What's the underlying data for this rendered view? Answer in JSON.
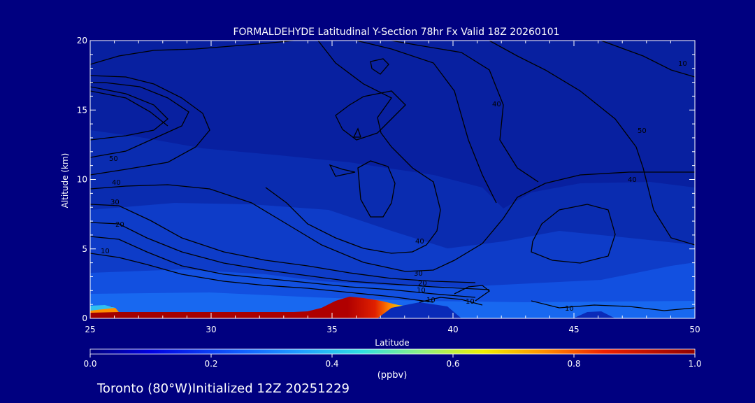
{
  "chart_data": {
    "type": "heatmap",
    "title": "FORMALDEHYDE Latitudinal Y-Section 78hr  Fx Valid 18Z 20260101",
    "xlabel": "Latitude",
    "ylabel": "Altitude (km)",
    "xlim": [
      25,
      50
    ],
    "ylim": [
      0,
      20
    ],
    "x_ticks": [
      25,
      30,
      35,
      40,
      45,
      50
    ],
    "y_ticks": [
      0,
      5,
      10,
      15,
      20
    ],
    "colorbar": {
      "range": [
        0.0,
        1.0
      ],
      "ticks": [
        0.0,
        0.2,
        0.4,
        0.6,
        0.8,
        1.0
      ],
      "tick_labels": [
        "0.0",
        "0.2",
        "0.4",
        "0.6",
        "0.8",
        "1.0"
      ],
      "unit_label": "(ppbv)"
    },
    "surface_layer": [
      {
        "lat": 25.0,
        "top_km": 0.9,
        "value": 0.9
      },
      {
        "lat": 26.0,
        "top_km": 0.6,
        "value": 0.95
      },
      {
        "lat": 30.0,
        "top_km": 0.6,
        "value": 1.0
      },
      {
        "lat": 33.0,
        "top_km": 0.8,
        "value": 1.0
      },
      {
        "lat": 34.0,
        "top_km": 0.6,
        "value": 0.8
      },
      {
        "lat": 35.0,
        "top_km": 1.0,
        "value": 0.55
      },
      {
        "lat": 36.0,
        "top_km": 1.6,
        "value": 0.45
      },
      {
        "lat": 37.0,
        "top_km": 1.4,
        "value": 0.35
      },
      {
        "lat": 38.0,
        "top_km": 0.8,
        "value": 0.15
      },
      {
        "lat": 40.0,
        "top_km": 0.6,
        "value": 0.1
      }
    ],
    "contour_labels": [
      "10",
      "20",
      "30",
      "40",
      "50",
      "40",
      "30",
      "20",
      "10",
      "10",
      "10",
      "10",
      "40",
      "40",
      "50",
      "10"
    ]
  },
  "footer": {
    "location": "Toronto (80°W)Initialized 12Z 20251229"
  },
  "colors": {
    "background": "#000080",
    "axes": "#ffffff",
    "contour": "#000000"
  }
}
